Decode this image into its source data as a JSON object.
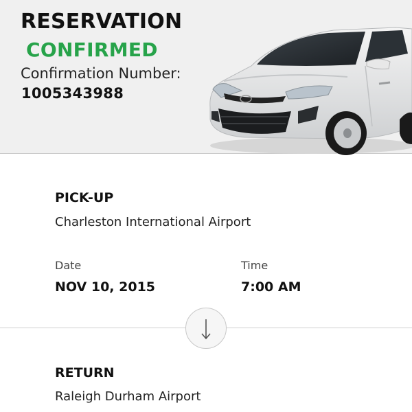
{
  "header": {
    "title": "RESERVATION",
    "status": "CONFIRMED",
    "confirmation_label": "Confirmation Number:",
    "confirmation_number": "1005343988",
    "car_image_icon": "white-sedan-car-image",
    "status_color": "#27a34a"
  },
  "pickup": {
    "heading": "PICK-UP",
    "location": "Charleston International Airport",
    "date_label": "Date",
    "date_value": "NOV 10, 2015",
    "time_label": "Time",
    "time_value": "7:00 AM"
  },
  "separator": {
    "icon": "down-arrow-icon"
  },
  "return": {
    "heading": "RETURN",
    "location": "Raleigh Durham Airport"
  }
}
